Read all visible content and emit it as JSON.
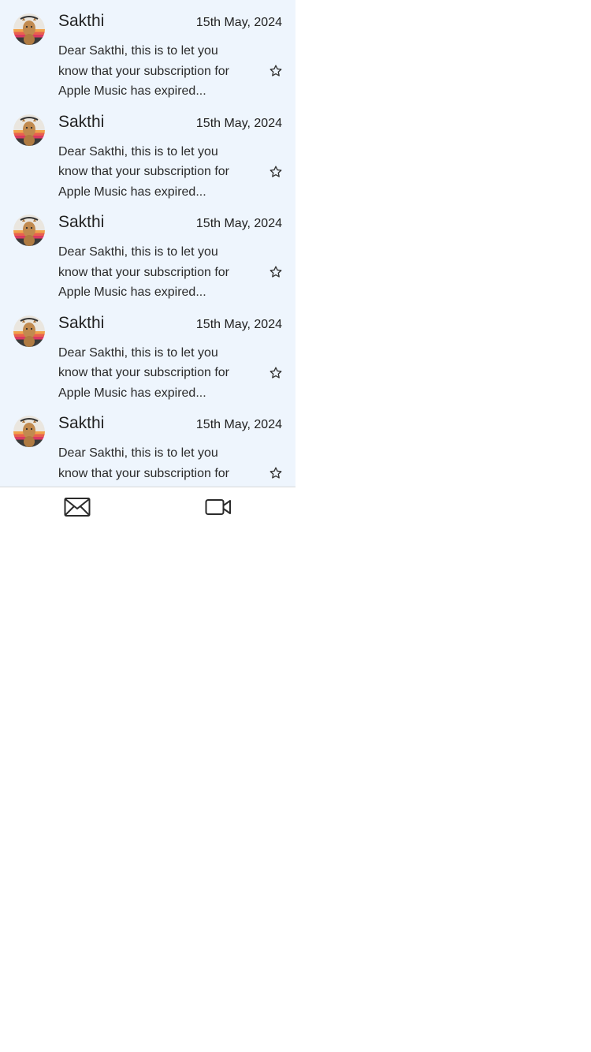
{
  "colors": {
    "list_background": "#eef5fd",
    "bottom_bar_background": "#ffffff",
    "text": "#222222"
  },
  "emails": [
    {
      "sender": "Sakthi",
      "date": "15th May, 2024",
      "preview": "Dear Sakthi, this is to let you know that your subscription for Apple Music has expired...",
      "starred": false
    },
    {
      "sender": "Sakthi",
      "date": "15th May, 2024",
      "preview": "Dear Sakthi, this is to let you know that your subscription for Apple Music has expired...",
      "starred": false
    },
    {
      "sender": "Sakthi",
      "date": "15th May, 2024",
      "preview": "Dear Sakthi, this is to let you know that your subscription for Apple Music has expired...",
      "starred": false
    },
    {
      "sender": "Sakthi",
      "date": "15th May, 2024",
      "preview": "Dear Sakthi, this is to let you know that your subscription for Apple Music has expired...",
      "starred": false
    },
    {
      "sender": "Sakthi",
      "date": "15th May, 2024",
      "preview": "Dear Sakthi, this is to let you know that your subscription for Apple Music has expired...",
      "starred": false
    }
  ],
  "bottom_nav": [
    {
      "icon": "mail-icon"
    },
    {
      "icon": "video-camera-icon"
    }
  ]
}
